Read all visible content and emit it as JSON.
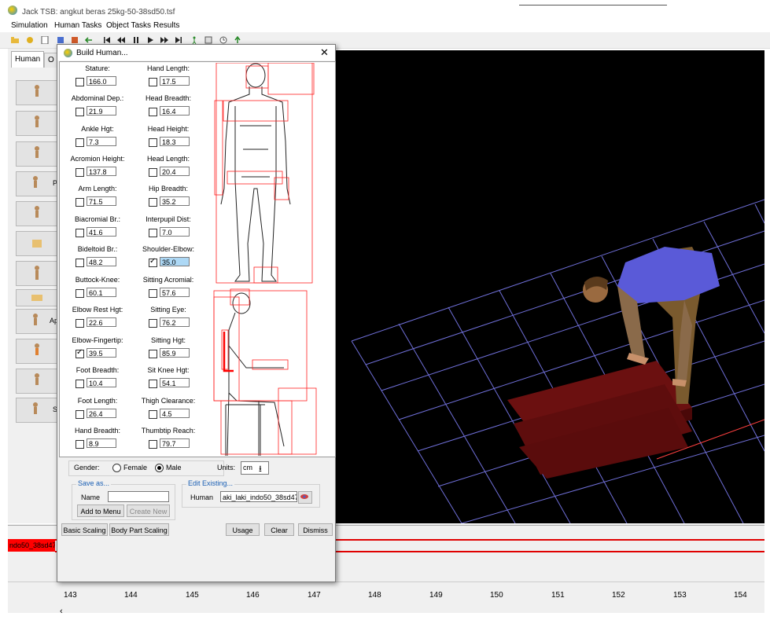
{
  "app": {
    "title": "Jack TSB:  angkut beras 25kg-50-38sd50.tsf",
    "menu": [
      "Simulation",
      "Human Tasks",
      "Object Tasks",
      "Results"
    ]
  },
  "left_panel": {
    "tabs": [
      "Human",
      "O"
    ],
    "partial_labels": [
      "P",
      "Ap",
      "S"
    ]
  },
  "dialog": {
    "title": "Build Human...",
    "measurements_left": [
      {
        "label": "Stature:",
        "value": "166.0",
        "checked": false
      },
      {
        "label": "Abdominal Dep.:",
        "value": "21.9",
        "checked": false
      },
      {
        "label": "Ankle Hgt:",
        "value": "7.3",
        "checked": false
      },
      {
        "label": "Acromion Height:",
        "value": "137.8",
        "checked": false
      },
      {
        "label": "Arm Length:",
        "value": "71.5",
        "checked": false
      },
      {
        "label": "Biacromial Br.:",
        "value": "41.6",
        "checked": false
      },
      {
        "label": "Bideltoid Br.:",
        "value": "48.2",
        "checked": false
      },
      {
        "label": "Buttock-Knee:",
        "value": "60.1",
        "checked": false
      },
      {
        "label": "Elbow Rest Hgt:",
        "value": "22.6",
        "checked": false
      },
      {
        "label": "Elbow-Fingertip:",
        "value": "39.5",
        "checked": true
      },
      {
        "label": "Foot Breadth:",
        "value": "10.4",
        "checked": false
      },
      {
        "label": "Foot Length:",
        "value": "26.4",
        "checked": false
      },
      {
        "label": "Hand Breadth:",
        "value": "8.9",
        "checked": false
      }
    ],
    "measurements_right": [
      {
        "label": "Hand Length:",
        "value": "17.5",
        "checked": false
      },
      {
        "label": "Head Breadth:",
        "value": "16.4",
        "checked": false
      },
      {
        "label": "Head Height:",
        "value": "18.3",
        "checked": false
      },
      {
        "label": "Head Length:",
        "value": "20.4",
        "checked": false
      },
      {
        "label": "Hip Breadth:",
        "value": "35.2",
        "checked": false
      },
      {
        "label": "Interpupil Dist:",
        "value": "7.0",
        "checked": false
      },
      {
        "label": "Shoulder-Elbow:",
        "value": "35.0",
        "checked": true
      },
      {
        "label": "Sitting Acromial:",
        "value": "57.6",
        "checked": false
      },
      {
        "label": "Sitting Eye:",
        "value": "76.2",
        "checked": false
      },
      {
        "label": "Sitting Hgt:",
        "value": "85.9",
        "checked": false
      },
      {
        "label": "Sit Knee Hgt:",
        "value": "54.1",
        "checked": false
      },
      {
        "label": "Thigh Clearance:",
        "value": "4.5",
        "checked": false
      },
      {
        "label": "Thumbtip Reach:",
        "value": "79.7",
        "checked": false
      }
    ],
    "gender_label": "Gender:",
    "gender_options": [
      "Female",
      "Male"
    ],
    "gender_selected": "Male",
    "units_label": "Units:",
    "units_value": "cm",
    "save_as": {
      "title": "Save as...",
      "name_label": "Name",
      "name_value": "",
      "add_button": "Add to Menu",
      "create_button": "Create New"
    },
    "edit_existing": {
      "title": "Edit Existing...",
      "human_label": "Human",
      "human_value": "aki_laki_indo50_38sd47"
    },
    "buttons": {
      "basic_scaling": "Basic Scaling",
      "body_part_scaling": "Body Part Scaling",
      "usage": "Usage",
      "clear": "Clear",
      "dismiss": "Dismiss"
    }
  },
  "timeline": {
    "track_label": "ndo50_38sd47",
    "ticks": [
      "143",
      "144",
      "145",
      "146",
      "147",
      "148",
      "149",
      "150",
      "151",
      "152",
      "153",
      "154"
    ]
  },
  "colors": {
    "grid": "#6f6fd8",
    "shirt": "#5a5ad8",
    "pants": "#7a5a2e",
    "box": "#6b1010",
    "track": "#ff0000",
    "selected_field": "#add8f5"
  }
}
